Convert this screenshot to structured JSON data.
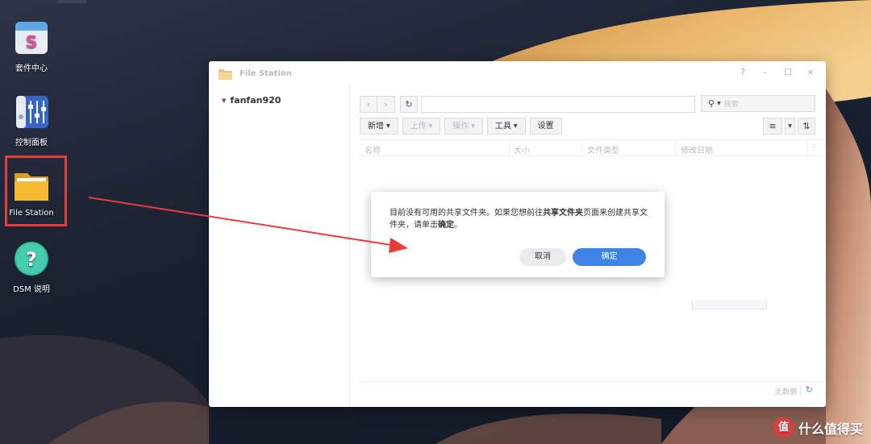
{
  "desktop": {
    "icons": [
      {
        "label": "套件中心",
        "icon": "package-center-icon"
      },
      {
        "label": "控制面板",
        "icon": "control-panel-icon"
      },
      {
        "label": "File Station",
        "icon": "file-station-icon"
      },
      {
        "label": "DSM 说明",
        "icon": "help-icon"
      }
    ],
    "highlight_color": "#ea3b3b"
  },
  "window": {
    "title": "File Station",
    "controls": [
      "?",
      "–",
      "☐",
      "×"
    ],
    "tree": {
      "root": "fanfan920"
    },
    "toolbar": {
      "back": "‹",
      "forward": "›",
      "refresh": "↻",
      "path_value": "",
      "search_placeholder": "搜索",
      "buttons": [
        {
          "label": "新增",
          "enabled": true
        },
        {
          "label": "上传",
          "enabled": false
        },
        {
          "label": "操作",
          "enabled": false
        },
        {
          "label": "工具",
          "enabled": true
        },
        {
          "label": "设置",
          "enabled": true
        }
      ]
    },
    "columns": [
      "名称",
      "大小",
      "文件类型",
      "修改日期"
    ],
    "status": {
      "text": "无数据"
    }
  },
  "dialog": {
    "message_part1": "目前没有可用的共享文件夹。如果您想前往",
    "message_bold1": "共享文件夹",
    "message_part2": "页面来创建共享文件夹，请单击",
    "message_bold2": "确定",
    "message_part3": "。",
    "cancel_label": "取消",
    "ok_label": "确定",
    "ok_color": "#3d84e6"
  },
  "watermark": {
    "logo": "值",
    "text": "什么值得买"
  }
}
